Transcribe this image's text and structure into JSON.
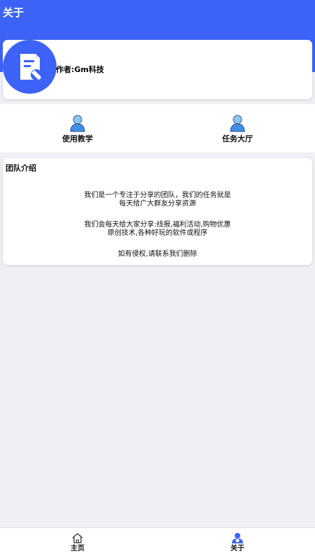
{
  "header": {
    "title": "关于"
  },
  "profile": {
    "author": "作者:Gm科技"
  },
  "quick_links": [
    {
      "label": "使用教学",
      "icon": "user-icon"
    },
    {
      "label": "任务大厅",
      "icon": "user-icon"
    }
  ],
  "team": {
    "title": "团队介绍",
    "paragraphs": [
      "我们是一个专注于分享的团队，我们的任务就是",
      "每天给广大群友分享资源",
      "我们会每天给大家分享:线报,福利活动,购物优惠",
      "原创技术,各种好玩的软件或程序",
      "如有侵权,请联系我们删除"
    ]
  },
  "tabs": [
    {
      "label": "主页",
      "icon": "home-icon"
    },
    {
      "label": "关于",
      "icon": "about-icon",
      "active": true
    }
  ],
  "colors": {
    "accent": "#3d63f6",
    "background": "#efeff4"
  }
}
